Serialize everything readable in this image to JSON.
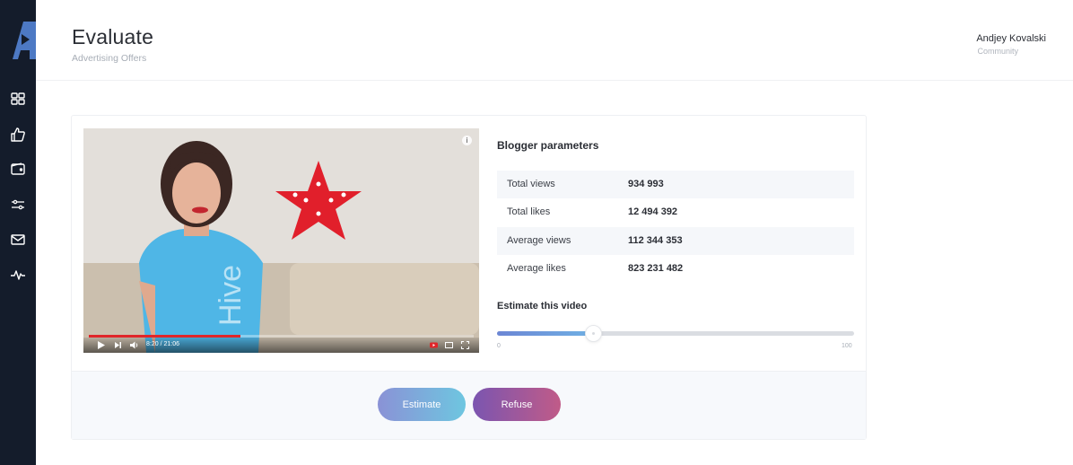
{
  "header": {
    "title": "Evaluate",
    "subtitle": "Advertising Offers"
  },
  "user": {
    "name": "Andjey Kovalski",
    "role": "Community"
  },
  "sidebar": {
    "items": [
      {
        "icon": "dashboard-icon"
      },
      {
        "icon": "thumbs-up-icon"
      },
      {
        "icon": "wallet-icon"
      },
      {
        "icon": "sliders-icon"
      },
      {
        "icon": "mail-icon"
      },
      {
        "icon": "activity-icon"
      }
    ]
  },
  "video": {
    "time": "8:20 / 21:06",
    "progress": 0.395
  },
  "parameters": {
    "title": "Blogger parameters",
    "rows": [
      {
        "label": "Total views",
        "value": "934 993"
      },
      {
        "label": "Total likes",
        "value": "12 494 392"
      },
      {
        "label": "Average views",
        "value": "112 344 353"
      },
      {
        "label": "Average likes",
        "value": "823 231 482"
      }
    ]
  },
  "estimate": {
    "title": "Estimate this video",
    "min": "0",
    "max": "100",
    "value": 27
  },
  "actions": {
    "estimate_label": "Estimate",
    "refuse_label": "Refuse"
  },
  "colors": {
    "sidebar": "#141c2b",
    "accent_blue": "#6c86d4",
    "refuse_purple": "#7b55b0"
  }
}
